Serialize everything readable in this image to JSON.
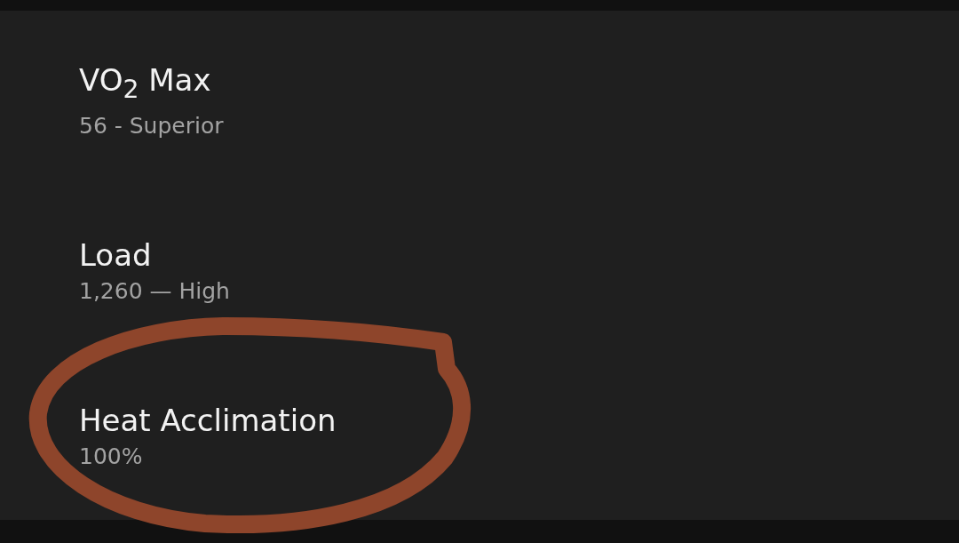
{
  "items": [
    {
      "title": "VO$_{2}$ Max",
      "value": "56 - Superior",
      "circled": false
    },
    {
      "title": "Load",
      "value": "1,260 — High",
      "circled": false
    },
    {
      "title": "Heat Acclimation",
      "value": "100%",
      "circled": true
    }
  ]
}
